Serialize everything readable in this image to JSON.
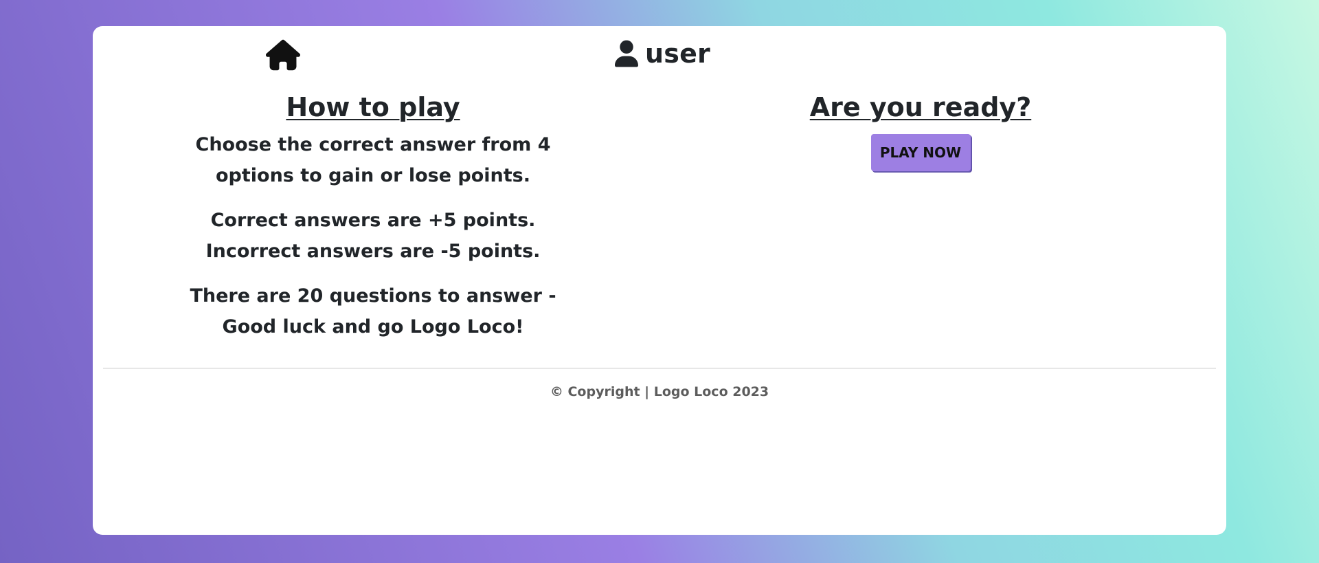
{
  "colors": {
    "accent": "#9d7fe3",
    "text": "#212529",
    "footer_text": "#5c5c5c",
    "card": "#ffffff"
  },
  "nav": {
    "home_icon": "home-icon",
    "user_icon": "user-icon",
    "username": "user"
  },
  "instructions": {
    "heading": "How to play",
    "paragraphs": [
      "Choose the correct answer from 4 options to gain or lose points.",
      "Correct answers are +5 points. Incorrect answers are -5 points.",
      "There are 20 questions to answer - Good luck and go Logo Loco!"
    ]
  },
  "start": {
    "heading": "Are you ready?",
    "button_label": "PLAY NOW"
  },
  "footer": {
    "text": "© Copyright | Logo Loco 2023"
  }
}
